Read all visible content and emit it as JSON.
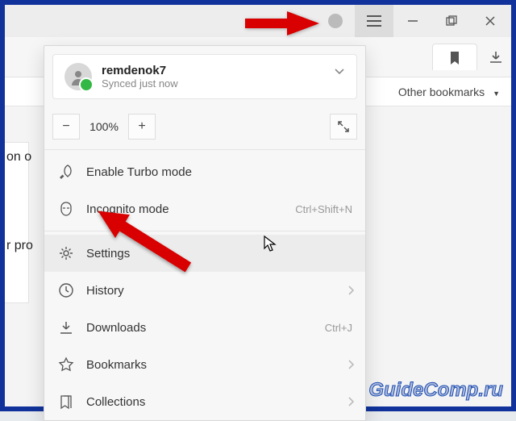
{
  "titlebar": {
    "hamburger": "hamburger-icon",
    "minimize": "minimize-icon",
    "maximize": "maximize-icon",
    "close": "close-icon"
  },
  "toolbar": {
    "bookmark": "bookmark-icon",
    "download": "download-icon"
  },
  "bookmarks_bar": {
    "other": "Other bookmarks",
    "caret": "▼"
  },
  "page_fragments": {
    "line1": "on o",
    "line2": "r pro"
  },
  "menu": {
    "account": {
      "name": "remdenok7",
      "status": "Synced just now"
    },
    "zoom": {
      "minus": "−",
      "value": "100%",
      "plus": "+"
    },
    "items": [
      {
        "icon": "rocket-icon",
        "label": "Enable Turbo mode",
        "shortcut": "",
        "has_submenu": false
      },
      {
        "icon": "incognito-icon",
        "label": "Incognito mode",
        "shortcut": "Ctrl+Shift+N",
        "has_submenu": false
      },
      {
        "separator": true
      },
      {
        "icon": "gear-icon",
        "label": "Settings",
        "shortcut": "",
        "has_submenu": false
      },
      {
        "icon": "history-icon",
        "label": "History",
        "shortcut": "",
        "has_submenu": true
      },
      {
        "icon": "download-icon",
        "label": "Downloads",
        "shortcut": "Ctrl+J",
        "has_submenu": false
      },
      {
        "icon": "star-icon",
        "label": "Bookmarks",
        "shortcut": "",
        "has_submenu": true
      },
      {
        "icon": "collections-icon",
        "label": "Collections",
        "shortcut": "",
        "has_submenu": true
      }
    ]
  },
  "watermark": "GuideComp.ru"
}
